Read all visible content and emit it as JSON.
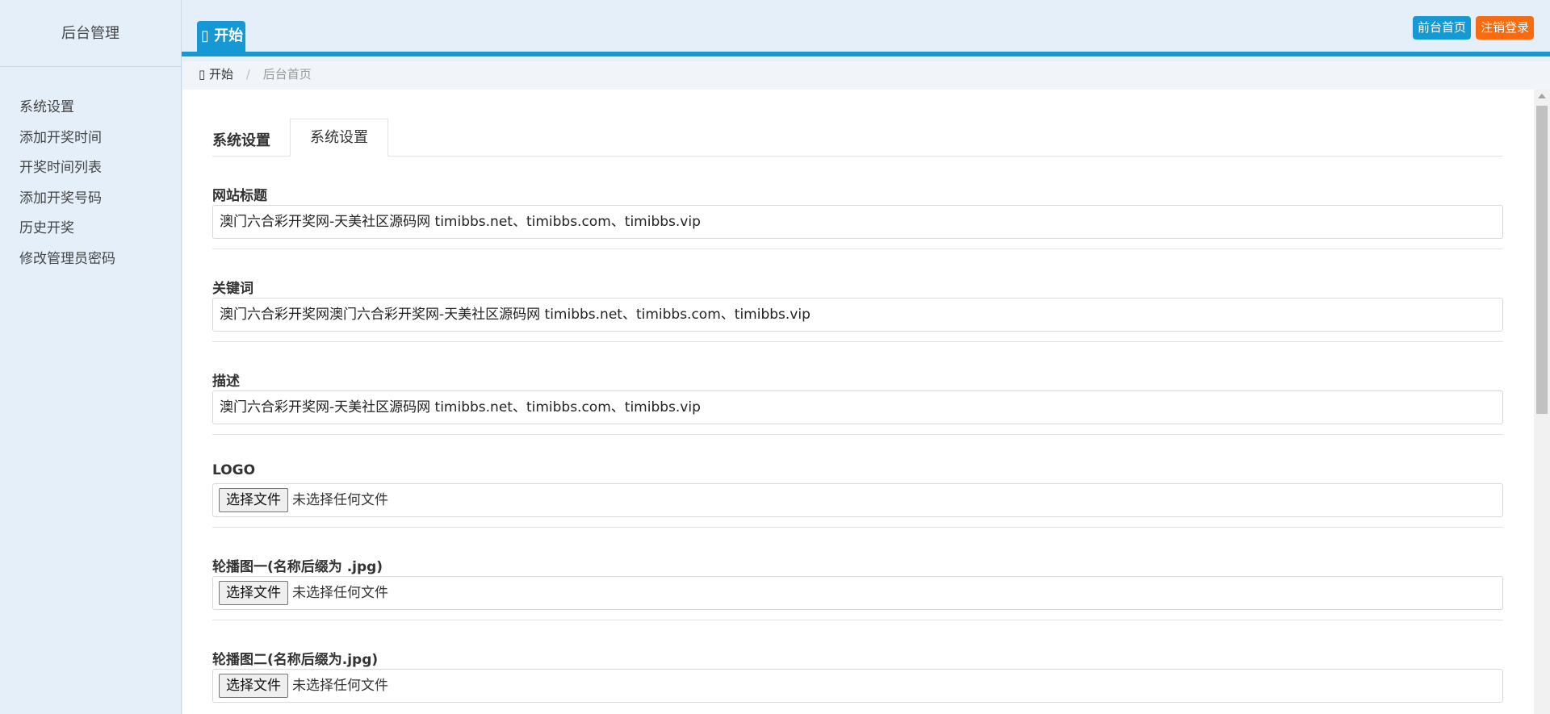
{
  "sidebar": {
    "title": "后台管理",
    "items": [
      {
        "label": "系统设置"
      },
      {
        "label": "添加开奖时间"
      },
      {
        "label": "开奖时间列表"
      },
      {
        "label": "添加开奖号码"
      },
      {
        "label": "历史开奖"
      },
      {
        "label": "修改管理员密码"
      }
    ]
  },
  "header": {
    "tab_label": "开始",
    "tab_icon": "home-icon",
    "front_button": "前台首页",
    "logout_button": "注销登录",
    "colors": {
      "accent": "#1499d5",
      "logout": "#fa6a0f"
    }
  },
  "breadcrumb": {
    "current": "开始",
    "icon": "home-icon",
    "separator": "/",
    "parent": "后台首页"
  },
  "main": {
    "tab_title": "系统设置",
    "active_tab": "系统设置",
    "fields": [
      {
        "label": "网站标题",
        "value": "澳门六合彩开奖网-天美社区源码网 timibbs.net、timibbs.com、timibbs.vip"
      },
      {
        "label": "关键词",
        "value": "澳门六合彩开奖网澳门六合彩开奖网-天美社区源码网 timibbs.net、timibbs.com、timibbs.vip"
      },
      {
        "label": "描述",
        "value": "澳门六合彩开奖网-天美社区源码网 timibbs.net、timibbs.com、timibbs.vip"
      },
      {
        "label": "LOGO",
        "file_button": "选择文件",
        "file_status": "未选择任何文件"
      },
      {
        "label": "轮播图一(名称后缀为 .jpg)",
        "file_button": "选择文件",
        "file_status": "未选择任何文件"
      },
      {
        "label": "轮播图二(名称后缀为.jpg)",
        "file_button": "选择文件",
        "file_status": "未选择任何文件"
      }
    ]
  }
}
